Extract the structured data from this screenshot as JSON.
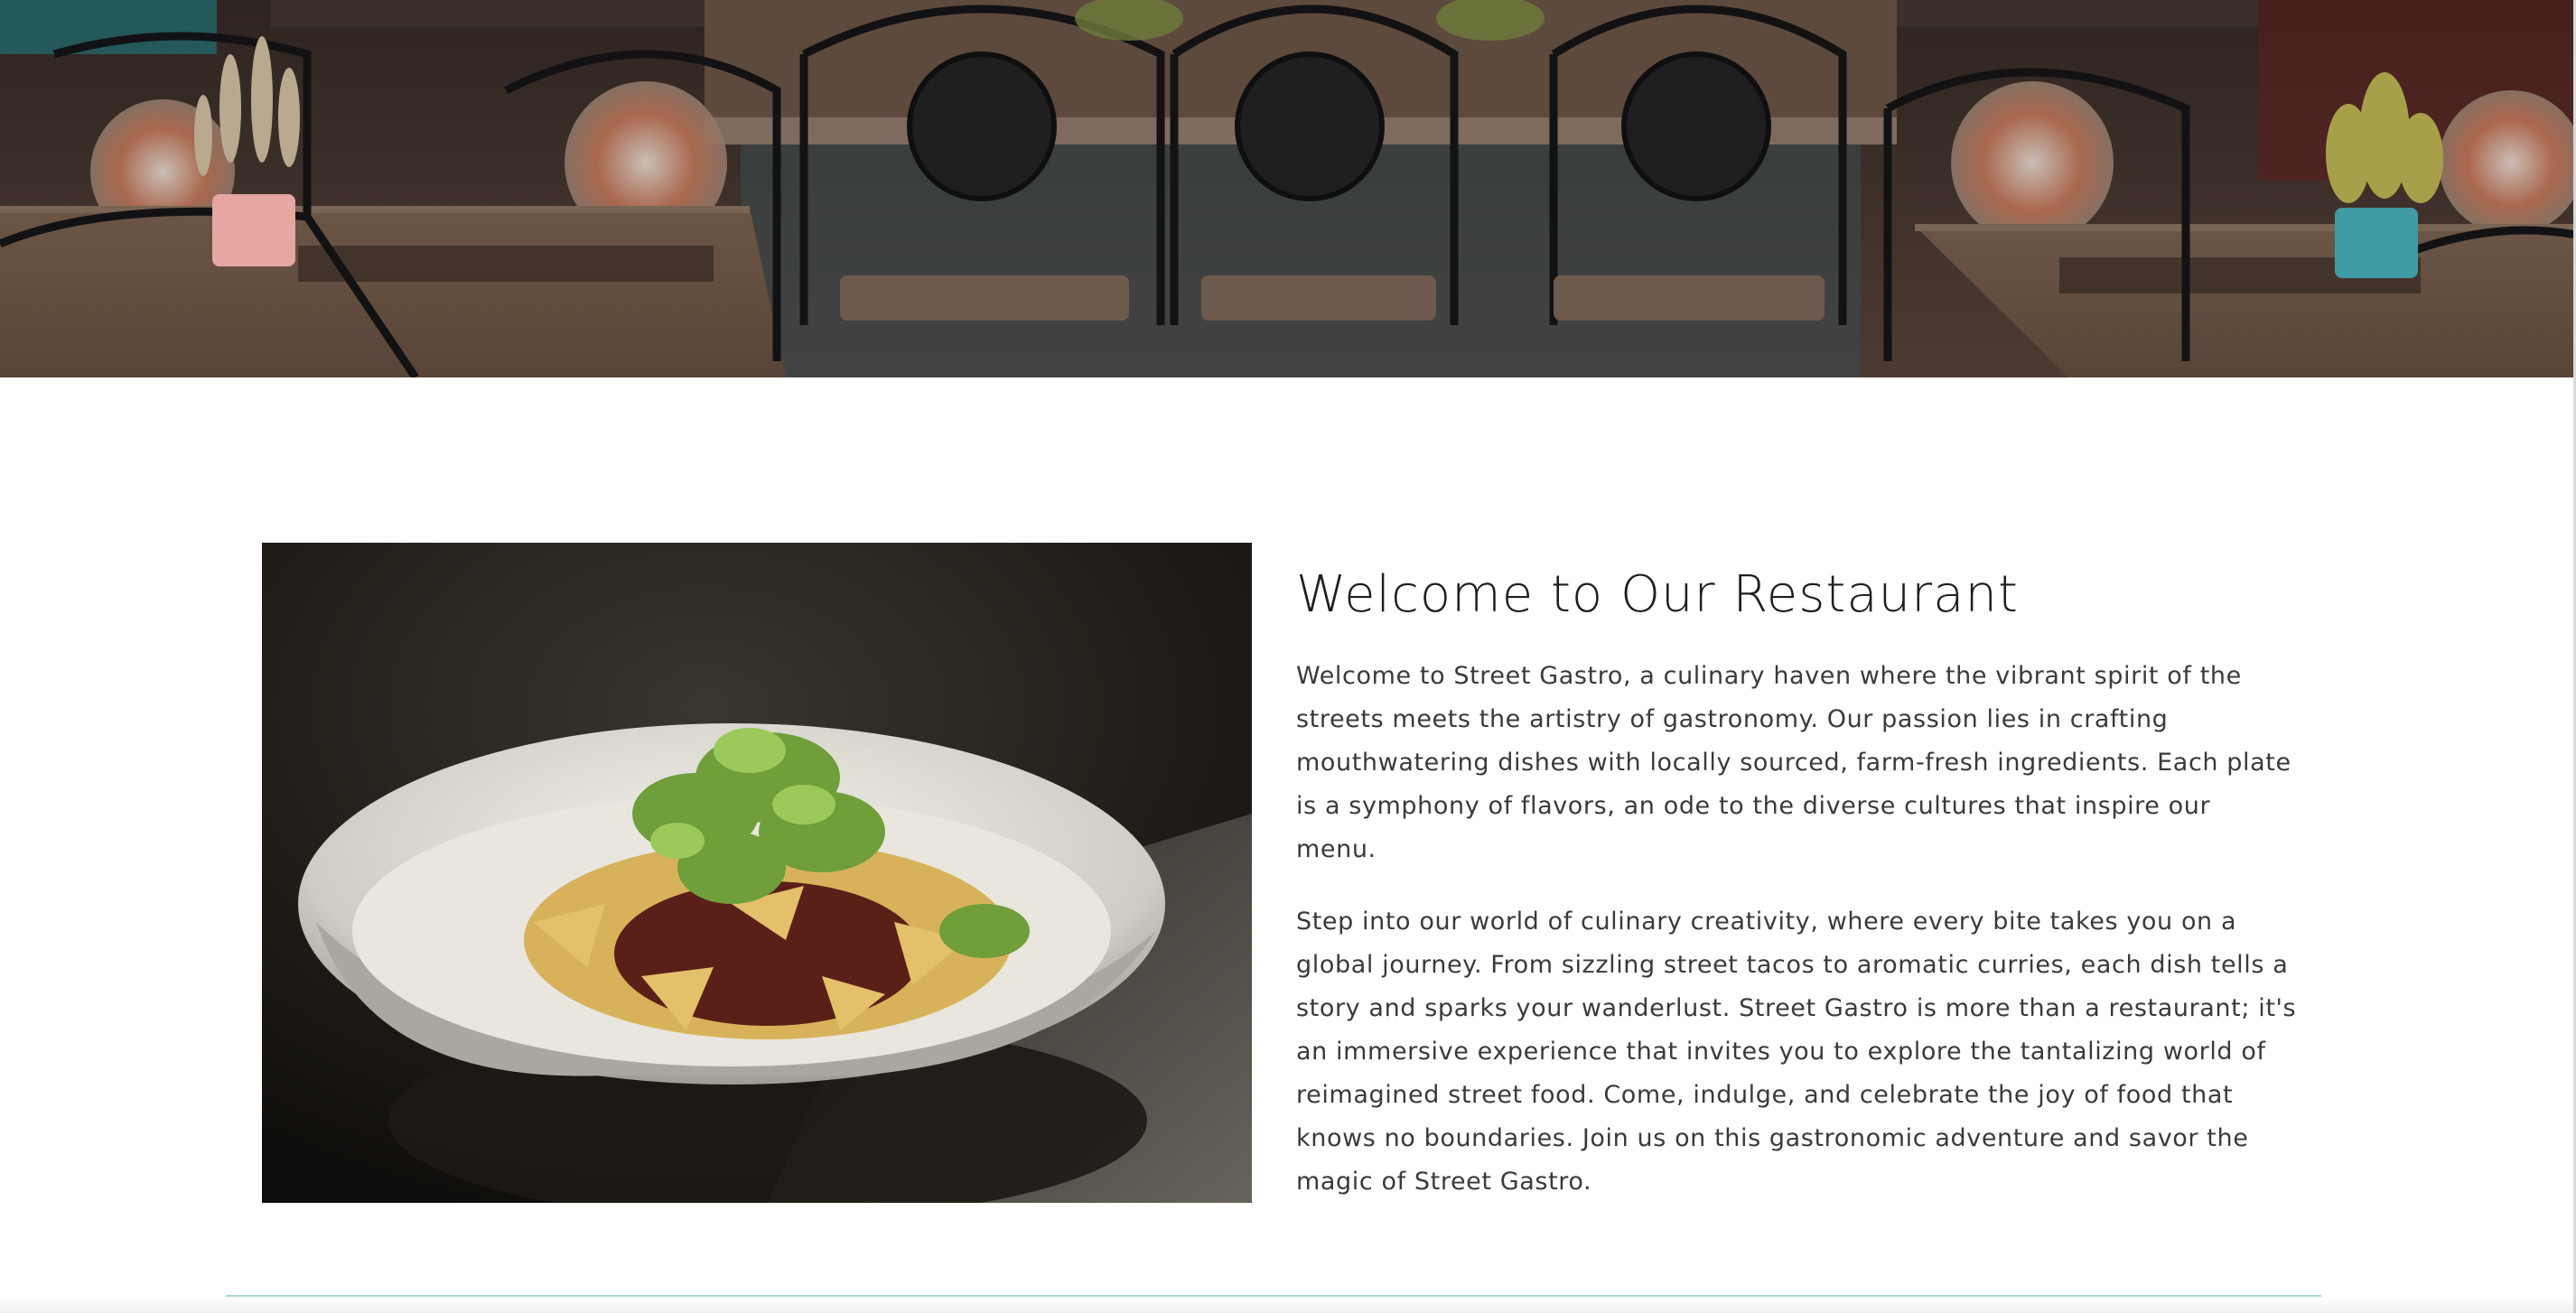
{
  "hero": {
    "icon": "restaurant-interior-photo"
  },
  "intro": {
    "image_icon": "dish-photo",
    "title": "Welcome to Our Restaurant",
    "paragraph_1": "Welcome to Street Gastro, a culinary haven where the vibrant spirit of the streets meets the artistry of gastronomy. Our passion lies in crafting mouthwatering dishes with locally sourced, farm-fresh ingredients. Each plate is a symphony of flavors, an ode to the diverse cultures that inspire our menu.",
    "paragraph_2": "Step into our world of culinary creativity, where every bite takes you on a global journey. From sizzling street tacos to aromatic curries, each dish tells a story and sparks your wanderlust. Street Gastro is more than a restaurant; it's an immersive experience that invites you to explore the tantalizing world of reimagined street food. Come, indulge, and celebrate the joy of food that knows no boundaries. Join us on this gastronomic adventure and savor the magic of Street Gastro."
  },
  "colors": {
    "divider": "#a7dcc3",
    "title": "#1e1e1e",
    "body_text": "#3a3a3a"
  }
}
